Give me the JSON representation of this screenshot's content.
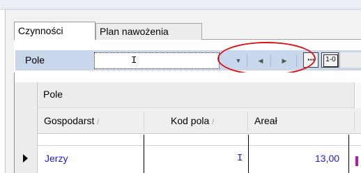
{
  "tabs": [
    {
      "label": "Czynności",
      "active": true
    },
    {
      "label": "Plan nawożenia",
      "active": false
    }
  ],
  "field_bar": {
    "label": "Pole",
    "value": "I",
    "buttons": [
      {
        "name": "dropdown",
        "glyph": "▼"
      },
      {
        "name": "previous",
        "glyph": "◀"
      },
      {
        "name": "next",
        "glyph": "▶"
      },
      {
        "name": "more",
        "glyph": "···"
      },
      {
        "name": "one-zero",
        "glyph": "1-0"
      }
    ]
  },
  "grid": {
    "group_by": "Pole",
    "columns": [
      {
        "label": "Gospodarstwo",
        "display": "Gospodarst",
        "sort_glyph": "/"
      },
      {
        "label": "Kod pola",
        "display": "Kod pola",
        "sort_glyph": "/"
      },
      {
        "label": "Areał",
        "display": "Areał",
        "sort_glyph": ""
      }
    ],
    "rows": [
      {
        "gospodarstwo": "Jerzy",
        "kod_pola": "I",
        "areal": "13,00",
        "current": true
      }
    ]
  },
  "colors": {
    "nav_row": "#c9d7ec",
    "cell_text": "#1a1af0",
    "highlight": "#dd1111"
  }
}
